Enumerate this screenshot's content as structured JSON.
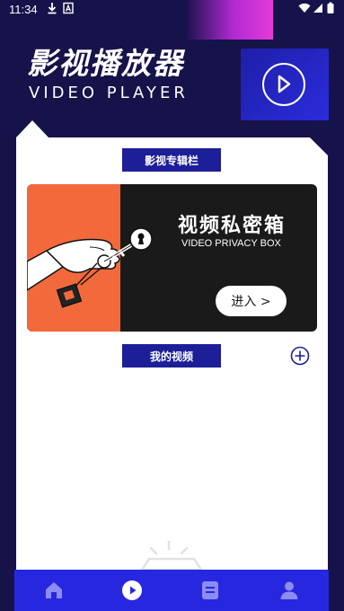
{
  "status_bar": {
    "time": "11:34",
    "left_icons": [
      "download-icon",
      "font-a-icon"
    ],
    "right_icons": [
      "wifi-icon",
      "signal-icon",
      "battery-icon"
    ]
  },
  "header": {
    "title": "影视播放器",
    "subtitle": "VIDEO PLAYER"
  },
  "sections": {
    "album_label": "影视专辑栏",
    "my_videos_label": "我的视频"
  },
  "banner": {
    "title": "视频私密箱",
    "subtitle": "VIDEO PRIVACY BOX",
    "enter_label": "进入 >"
  },
  "bottom_nav": {
    "items": [
      {
        "icon": "home-icon"
      },
      {
        "icon": "play-icon",
        "active": true
      },
      {
        "icon": "document-icon"
      },
      {
        "icon": "user-icon"
      }
    ]
  },
  "colors": {
    "background": "#16124a",
    "accent_blue": "#2727e0",
    "pill_blue": "#1c1f98",
    "banner_orange": "#f26a3c",
    "banner_dark": "#1a1a1a",
    "nav_icon": "#8c8cf2"
  }
}
